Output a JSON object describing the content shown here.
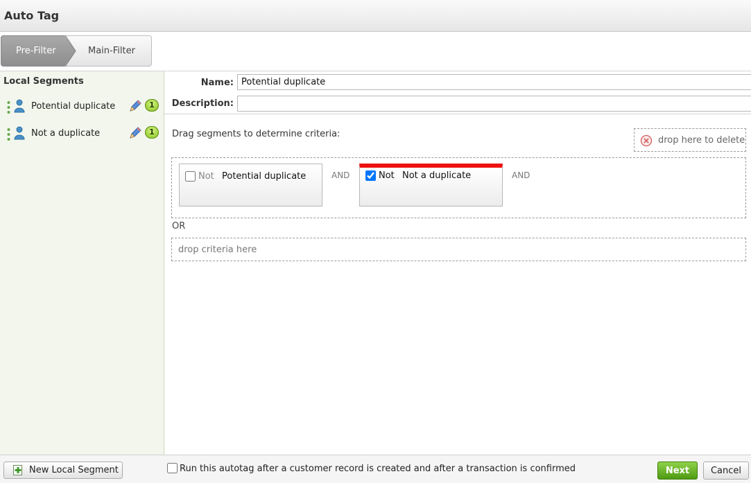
{
  "window": {
    "title": "Auto Tag"
  },
  "wizard": {
    "steps": [
      {
        "label": "Pre-Filter",
        "active": true
      },
      {
        "label": "Main-Filter",
        "active": false
      }
    ]
  },
  "sidebar": {
    "title": "Local Segments",
    "segments": [
      {
        "label": "Potential duplicate",
        "count": "1",
        "icon": "user-icon"
      },
      {
        "label": "Not a duplicate",
        "count": "1",
        "icon": "user-icon"
      }
    ]
  },
  "form": {
    "name_label": "Name:",
    "name_value": "Potential duplicate",
    "description_label": "Description:",
    "description_value": ""
  },
  "criteria": {
    "instruction": "Drag segments to determine criteria:",
    "delete_zone": "drop here to delete",
    "groups": [
      {
        "items": [
          {
            "not_label": "Not",
            "negated": false,
            "segment": "Potential duplicate"
          },
          {
            "not_label": "Not",
            "negated": true,
            "segment": "Not a duplicate"
          }
        ],
        "connectors": [
          "AND",
          "AND"
        ]
      }
    ],
    "or_label": "OR",
    "drop_zone": "drop criteria here"
  },
  "footer": {
    "new_segment_label": "New Local Segment",
    "run_label": "Run this autotag after a customer record is created and after a transaction is confirmed",
    "run_checked": false,
    "next_label": "Next",
    "cancel_label": "Cancel"
  },
  "colors": {
    "accent_green": "#6bb52a",
    "highlight_red": "#ee1111"
  }
}
